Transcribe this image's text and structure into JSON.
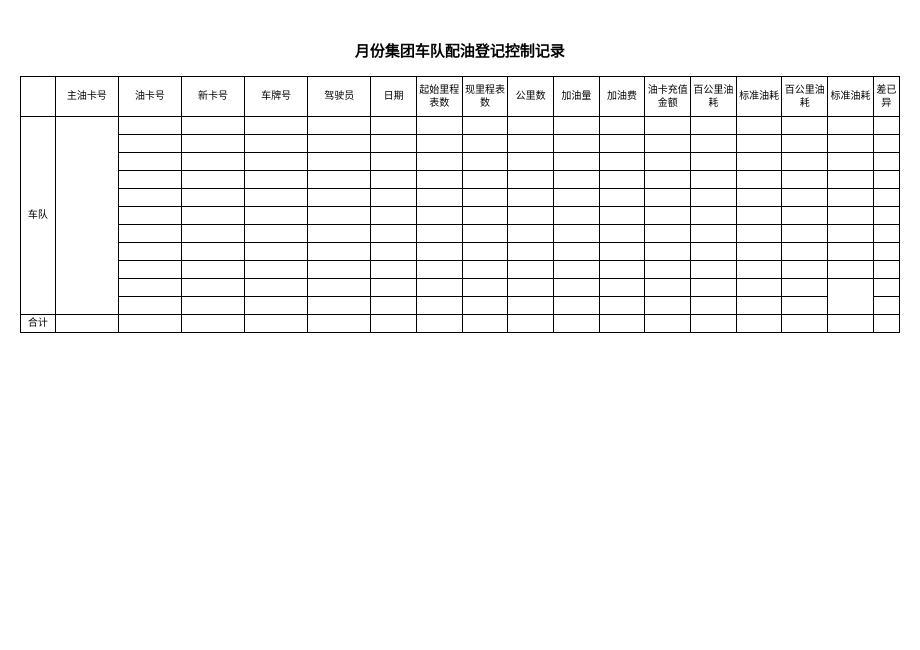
{
  "title": "月份集团车队配油登记控制记录",
  "headers": {
    "main_card": "主油卡号",
    "oil_card": "油卡号",
    "new_card": "新卡号",
    "plate": "车牌号",
    "driver": "驾驶员",
    "date": "日期",
    "start_odo": "起始里程表数",
    "current_odo": "现里程表数",
    "km": "公里数",
    "fuel_qty": "加油量",
    "fuel_cost": "加油费",
    "recharge": "油卡充值金额",
    "per100_1": "百公里油耗",
    "std_consume": "标准油耗",
    "per100_2": "百公里油耗",
    "std_consume2": "标准油耗",
    "diff": "差已异"
  },
  "row_labels": {
    "fleet": "车队",
    "total": "合计"
  }
}
